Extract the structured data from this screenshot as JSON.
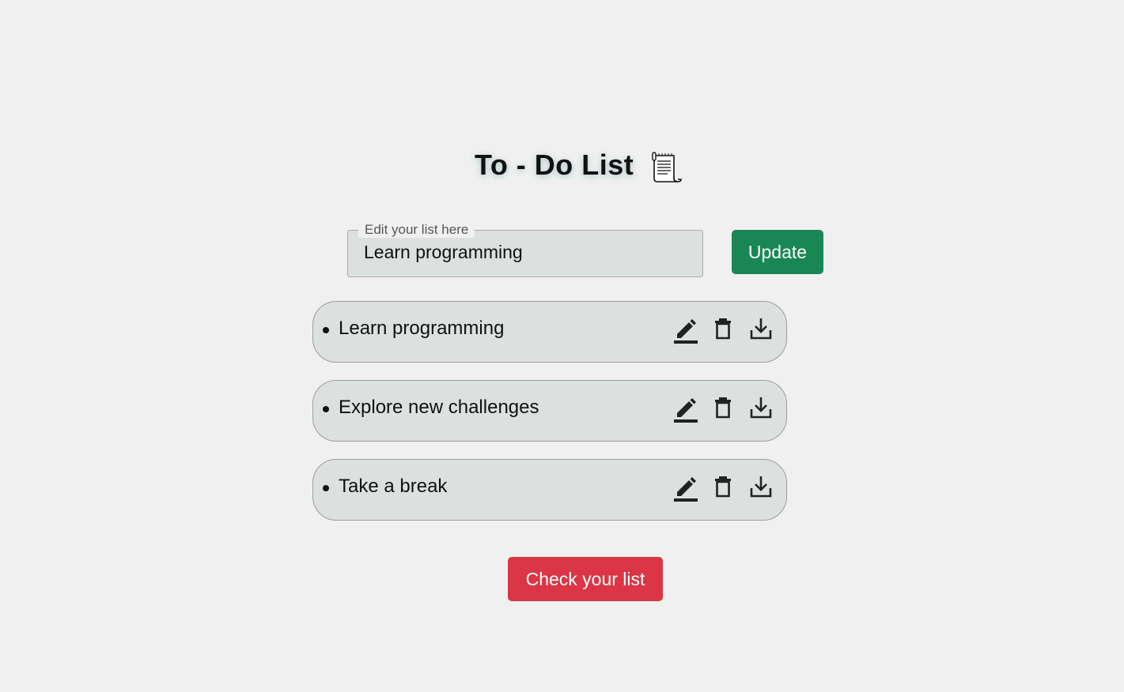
{
  "header": {
    "title": "To - Do List",
    "icon": "notepad-icon"
  },
  "editor": {
    "legend": "Edit your list here",
    "value": "Learn programming",
    "update_label": "Update"
  },
  "todos": [
    {
      "text": "Learn programming"
    },
    {
      "text": "Explore new challenges"
    },
    {
      "text": "Take a break"
    }
  ],
  "actions": {
    "edit_icon": "pencil-icon",
    "delete_icon": "trash-icon",
    "download_icon": "download-icon"
  },
  "footer": {
    "check_label": "Check your list"
  },
  "colors": {
    "background": "#f0f0f0",
    "card": "#dce1df",
    "update_button": "#198754",
    "check_button": "#dc3545"
  }
}
